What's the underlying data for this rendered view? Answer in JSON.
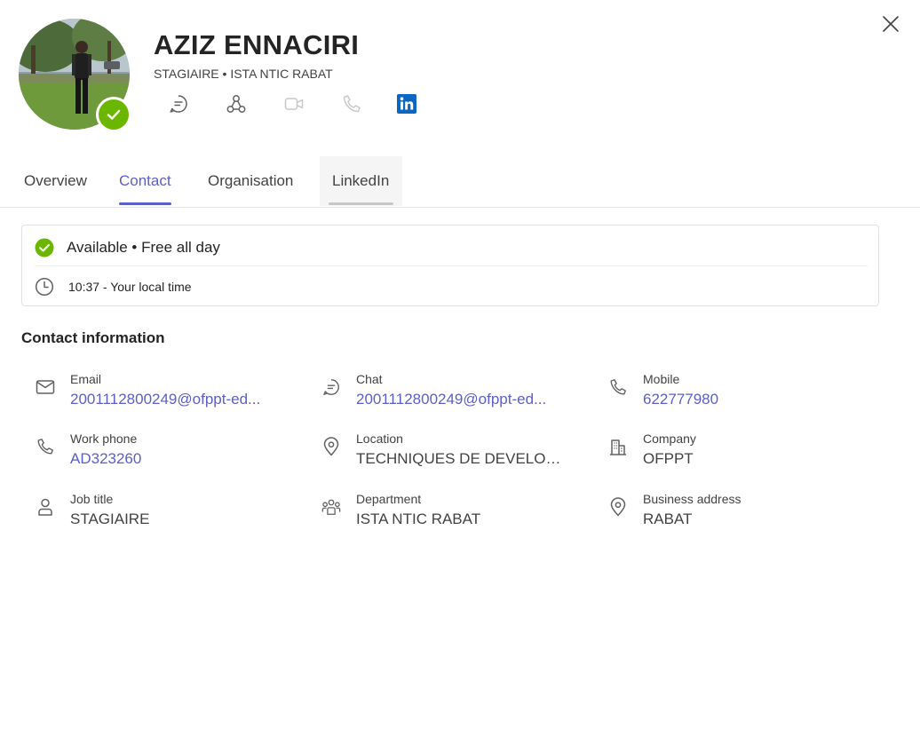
{
  "person": {
    "name": "AZIZ ENNACIRI",
    "subtitle": "STAGIAIRE • ISTA NTIC RABAT"
  },
  "actions": [
    {
      "icon": "chat-icon",
      "enabled": true
    },
    {
      "icon": "org-chart-icon",
      "enabled": true
    },
    {
      "icon": "video-call-icon",
      "enabled": false
    },
    {
      "icon": "phone-call-icon",
      "enabled": false
    },
    {
      "icon": "linkedin-icon",
      "enabled": true
    }
  ],
  "tabs": [
    {
      "label": "Overview",
      "active": false
    },
    {
      "label": "Contact",
      "active": true
    },
    {
      "label": "Organisation",
      "active": false
    },
    {
      "label": "LinkedIn",
      "active": false,
      "hover": true
    }
  ],
  "availability": {
    "status": "Available • Free all day",
    "local_time": "10:37 - Your local time"
  },
  "contact_info": {
    "title": "Contact information",
    "fields": [
      {
        "icon": "mail-icon",
        "label": "Email",
        "value": "2001112800249@ofppt-ed...",
        "link": true
      },
      {
        "icon": "chat-icon",
        "label": "Chat",
        "value": "2001112800249@ofppt-ed...",
        "link": true
      },
      {
        "icon": "phone-icon",
        "label": "Mobile",
        "value": "622777980",
        "link": true
      },
      {
        "icon": "phone-icon",
        "label": "Work phone",
        "value": "AD323260",
        "link": true
      },
      {
        "icon": "location-icon",
        "label": "Location",
        "value": "TECHNIQUES DE DEVELOPP...",
        "link": false
      },
      {
        "icon": "building-icon",
        "label": "Company",
        "value": "OFPPT",
        "link": false
      },
      {
        "icon": "person-icon",
        "label": "Job title",
        "value": "STAGIAIRE",
        "link": false
      },
      {
        "icon": "people-icon",
        "label": "Department",
        "value": "ISTA NTIC RABAT",
        "link": false
      },
      {
        "icon": "location-icon",
        "label": "Business address",
        "value": "RABAT",
        "link": false
      }
    ]
  },
  "colors": {
    "accent": "#5b5fc7",
    "available": "#6bb700",
    "linkedin": "#0a66c2"
  }
}
